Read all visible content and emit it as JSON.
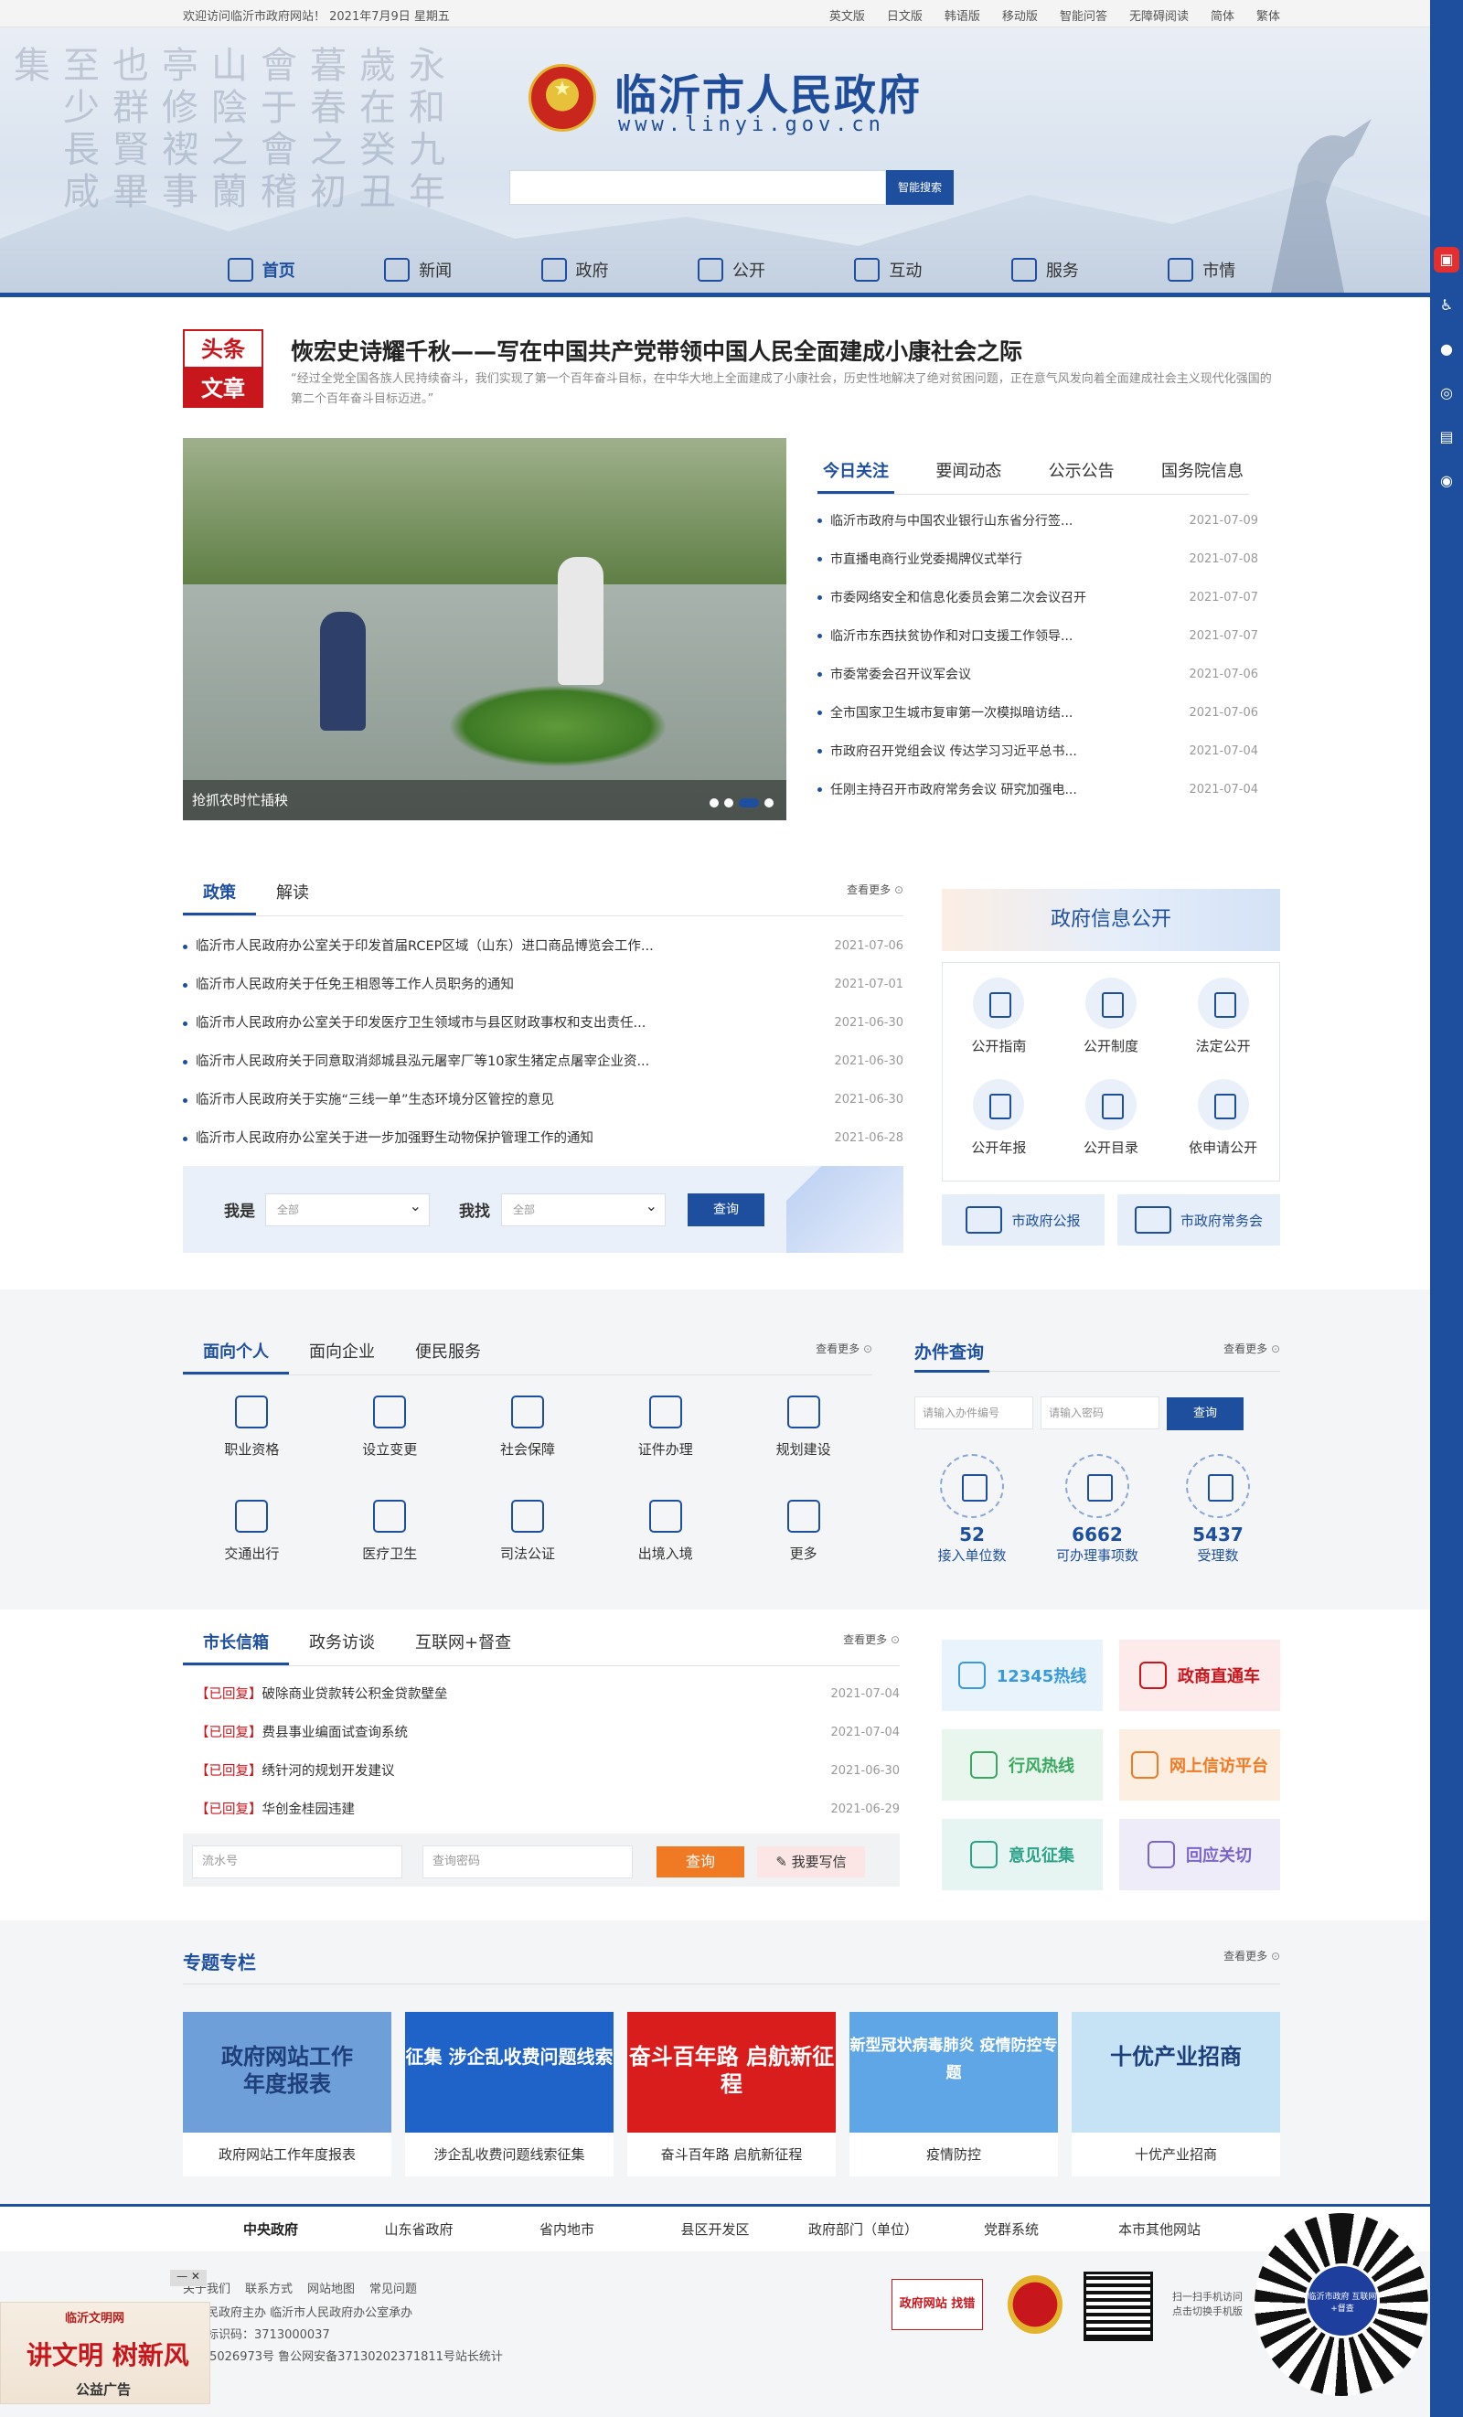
{
  "topbar": {
    "welcome": "欢迎访问临沂市政府网站！ 2021年7月9日 星期五",
    "links": [
      "英文版",
      "日文版",
      "韩语版",
      "移动版",
      "智能问答",
      "无障碍阅读",
      "简体",
      "繁体"
    ]
  },
  "header": {
    "title": "临沂市人民政府",
    "url": "www.linyi.gov.cn",
    "search_button": "智能搜索"
  },
  "nav": [
    "首页",
    "新闻",
    "政府",
    "公开",
    "互动",
    "服务",
    "市情"
  ],
  "headline": {
    "tag_top": "头条",
    "tag_bottom": "文章",
    "title": "恢宏史诗耀千秋——写在中国共产党带领中国人民全面建成小康社会之际",
    "summary": "“经过全党全国各族人民持续奋斗，我们实现了第一个百年奋斗目标，在中华大地上全面建成了小康社会，历史性地解决了绝对贫困问题，正在意气风发向着全面建成社会主义现代化强国的第二个百年奋斗目标迈进。”"
  },
  "slider": {
    "caption": "抢抓农时忙插秧",
    "slide_count": 4,
    "active_slide": 3
  },
  "news": {
    "tabs": [
      "今日关注",
      "要闻动态",
      "公示公告",
      "国务院信息"
    ],
    "items": [
      {
        "title": "临沂市政府与中国农业银行山东省分行签...",
        "date": "2021-07-09"
      },
      {
        "title": "市直播电商行业党委揭牌仪式举行",
        "date": "2021-07-08"
      },
      {
        "title": "市委网络安全和信息化委员会第二次会议召开",
        "date": "2021-07-07"
      },
      {
        "title": "临沂市东西扶贫协作和对口支援工作领导...",
        "date": "2021-07-07"
      },
      {
        "title": "市委常委会召开议军会议",
        "date": "2021-07-06"
      },
      {
        "title": "全市国家卫生城市复审第一次模拟暗访结...",
        "date": "2021-07-06"
      },
      {
        "title": "市政府召开党组会议 传达学习习近平总书...",
        "date": "2021-07-04"
      },
      {
        "title": "任刚主持召开市政府常务会议 研究加强电...",
        "date": "2021-07-04"
      }
    ]
  },
  "policy": {
    "tabs": [
      "政策",
      "解读"
    ],
    "more": "查看更多",
    "items": [
      {
        "title": "临沂市人民政府办公室关于印发首届RCEP区域（山东）进口商品博览会工作...",
        "date": "2021-07-06"
      },
      {
        "title": "临沂市人民政府关于任免王相恩等工作人员职务的通知",
        "date": "2021-07-01"
      },
      {
        "title": "临沂市人民政府办公室关于印发医疗卫生领域市与县区财政事权和支出责任...",
        "date": "2021-06-30"
      },
      {
        "title": "临沂市人民政府关于同意取消郯城县泓元屠宰厂等10家生猪定点屠宰企业资...",
        "date": "2021-06-30"
      },
      {
        "title": "临沂市人民政府关于实施“三线一单”生态环境分区管控的意见",
        "date": "2021-06-30"
      },
      {
        "title": "临沂市人民政府办公室关于进一步加强野生动物保护管理工作的通知",
        "date": "2021-06-28"
      }
    ],
    "filter": {
      "who_label": "我是",
      "who_value": "全部",
      "find_label": "我找",
      "find_value": "全部",
      "button": "查询"
    }
  },
  "govinfo": {
    "banner": "政府信息公开",
    "items": [
      "公开指南",
      "公开制度",
      "法定公开",
      "公开年报",
      "公开目录",
      "依申请公开"
    ],
    "buttons": [
      "市政府公报",
      "市政府常务会"
    ]
  },
  "services": {
    "tabs": [
      "面向个人",
      "面向企业",
      "便民服务"
    ],
    "more": "查看更多",
    "items": [
      "职业资格",
      "设立变更",
      "社会保障",
      "证件办理",
      "规划建设",
      "交通出行",
      "医疗卫生",
      "司法公证",
      "出境入境",
      "更多"
    ]
  },
  "affairs": {
    "title": "办件查询",
    "more": "查看更多",
    "input1": "请输入办件编号",
    "input2": "请输入密码",
    "button": "查询",
    "stats": [
      {
        "value": "52",
        "label": "接入单位数"
      },
      {
        "value": "6662",
        "label": "可办理事项数"
      },
      {
        "value": "5437",
        "label": "受理数"
      }
    ]
  },
  "mayor": {
    "tabs": [
      "市长信箱",
      "政务访谈",
      "互联网+督查"
    ],
    "more": "查看更多",
    "items": [
      {
        "status": "【已回复】",
        "title": "破除商业贷款转公积金贷款壁垒",
        "date": "2021-07-04"
      },
      {
        "status": "【已回复】",
        "title": "费县事业编面试查询系统",
        "date": "2021-07-04"
      },
      {
        "status": "【已回复】",
        "title": "绣针河的规划开发建议",
        "date": "2021-06-30"
      },
      {
        "status": "【已回复】",
        "title": "华创金桂园违建",
        "date": "2021-06-29"
      }
    ],
    "form": {
      "serial_placeholder": "流水号",
      "password_placeholder": "查询密码",
      "query_button": "查询",
      "write_button": "我要写信"
    }
  },
  "hotlines": [
    {
      "label": "12345热线",
      "color": "#3a9ad9",
      "bg": "#e8f3fb"
    },
    {
      "label": "政商直通车",
      "color": "#c8161d",
      "bg": "#fdeaea"
    },
    {
      "label": "行风热线",
      "color": "#3aa860",
      "bg": "#e8f6ee"
    },
    {
      "label": "网上信访平台",
      "color": "#f07a24",
      "bg": "#fdeee2"
    },
    {
      "label": "意见征集",
      "color": "#2fa38a",
      "bg": "#e6f5f1"
    },
    {
      "label": "回应关切",
      "color": "#7a66c8",
      "bg": "#efecf9"
    }
  ],
  "special": {
    "title": "专题专栏",
    "more": "查看更多",
    "cards": [
      {
        "caption": "政府网站工作年度报表",
        "banner": "政府网站工作\n年度报表",
        "bg": "#6f9fd8"
      },
      {
        "caption": "涉企乱收费问题线索征集",
        "banner": "征集 涉企乱收费问题线索",
        "bg": "#1f63c8"
      },
      {
        "caption": "奋斗百年路 启航新征程",
        "banner": "奋斗百年路 启航新征程",
        "bg": "#d91c1c"
      },
      {
        "caption": "疫情防控",
        "banner": "新型冠状病毒肺炎 疫情防控专题",
        "bg": "#5fa6e6"
      },
      {
        "caption": "十优产业招商",
        "banner": "十优产业招商",
        "bg": "#c6e3f6"
      }
    ]
  },
  "footer": {
    "links": [
      "中央政府",
      "山东省政府",
      "省内地市",
      "县区开发区",
      "政府部门（单位）",
      "党群系统",
      "本市其他网站"
    ],
    "nav": [
      "关于我们",
      "联系方式",
      "网站地图",
      "常见问题"
    ],
    "lines": [
      "市人民政府主办 临沂市人民政府办公室承办",
      "网站标识码：3713000037",
      "P备05026973号 鲁公网安备37130202371811号站长统计"
    ],
    "error_logo": "政府网站 找错",
    "qr_text": "扫一扫手机访问\n点击切换手机版",
    "mini_qr": "临沂市政府 互联网+督查"
  },
  "ad": {
    "top": "临沂文明网",
    "main": "讲文明 树新风",
    "bottom": "公益广告"
  }
}
